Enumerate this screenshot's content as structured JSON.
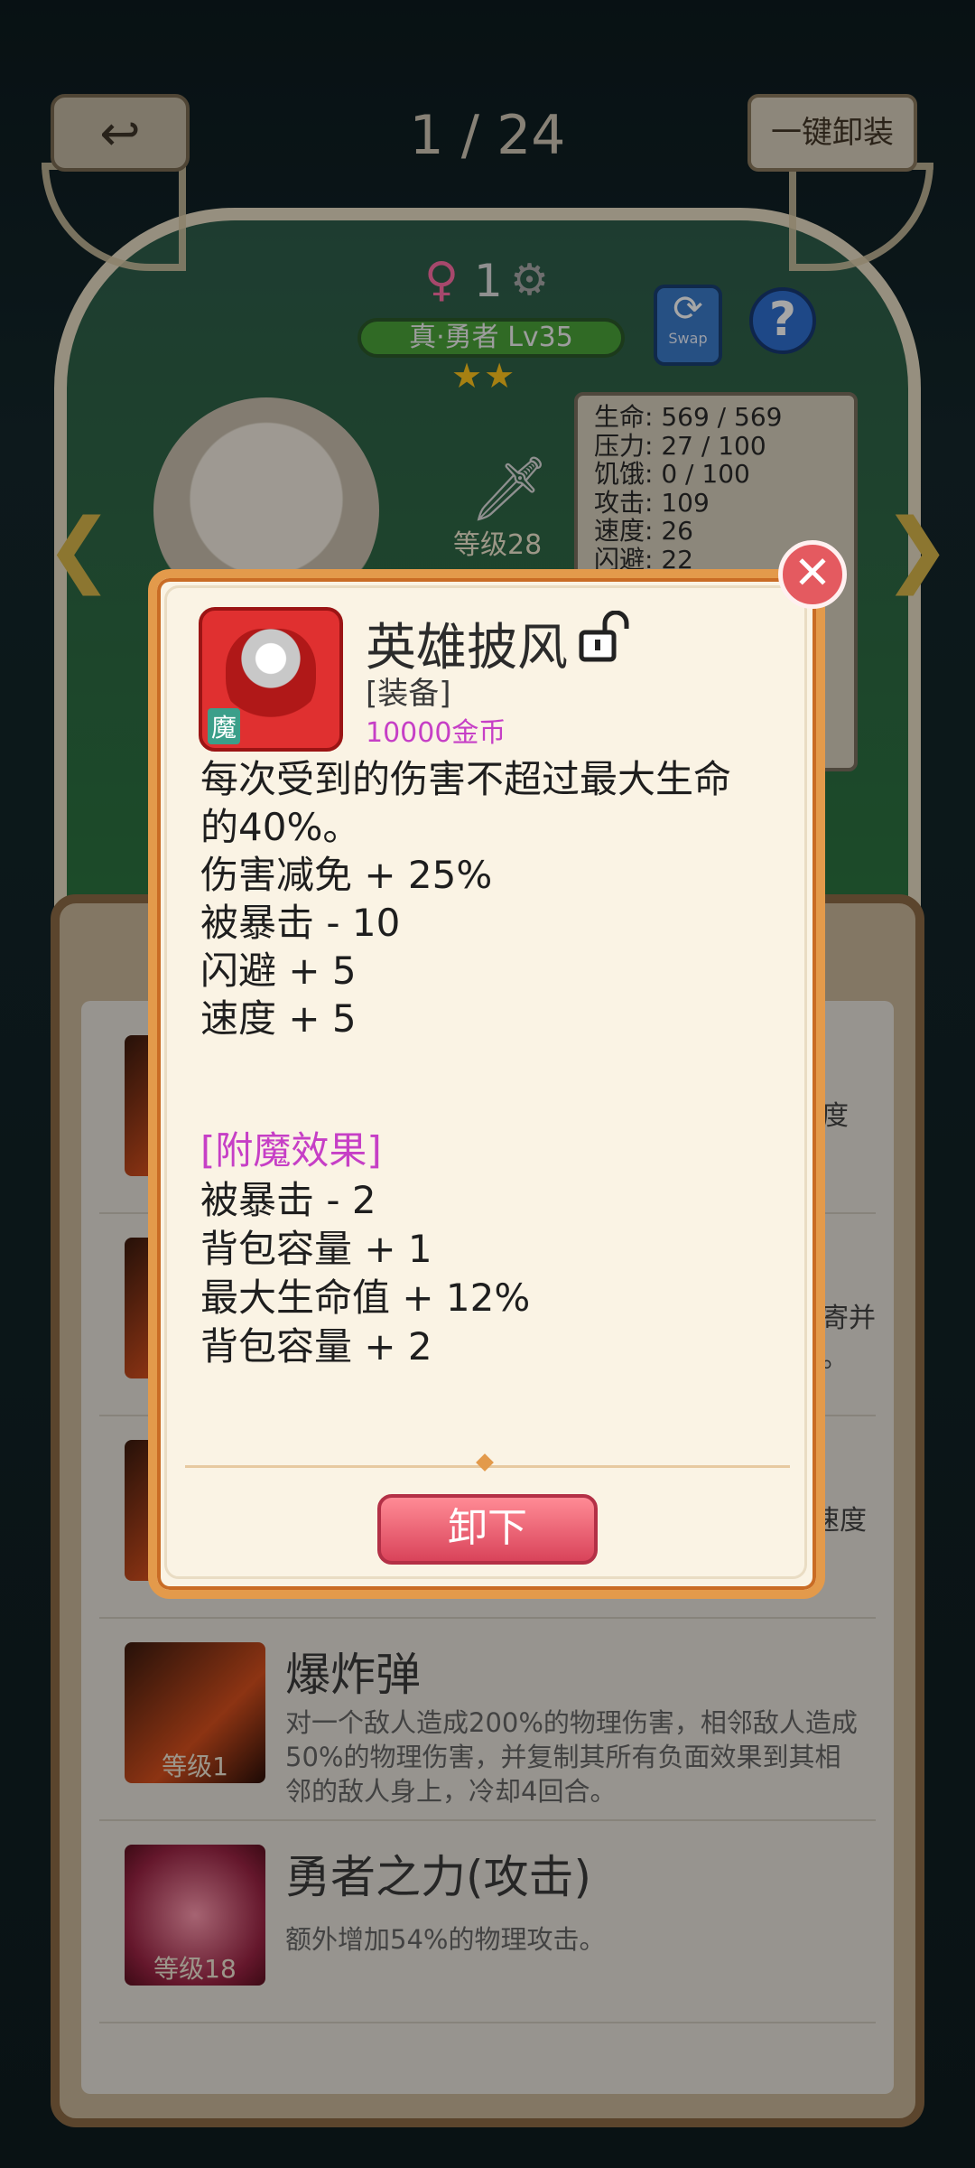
{
  "topbar": {
    "back_icon": "back-arrow-icon",
    "page_indicator": "1 / 24",
    "unequip_all_label": "一键卸装"
  },
  "hero": {
    "gender_symbol": "♀",
    "count": "1",
    "name": "真·勇者 Lv35",
    "stars": "★★",
    "swap_label": "Swap",
    "help_label": "?",
    "weapon_level": "等级28",
    "stats": [
      "生命: 569 / 569",
      "压力: 27 / 100",
      "饥饿: 0 / 100",
      "攻击: 109",
      "速度: 26",
      "闪避: 22"
    ]
  },
  "skills": [
    {
      "name": "",
      "desc": "度",
      "level": ""
    },
    {
      "name": "",
      "desc": "寄并\n。",
      "level": ""
    },
    {
      "name": "",
      "desc": "速度",
      "level": ""
    },
    {
      "name": "爆炸弹",
      "desc": "对一个敌人造成200%的物理伤害，相邻敌人造成50%的物理伤害，并复制其所有负面效果到其相邻的敌人身上，冷却4回合。",
      "level": "等级1"
    },
    {
      "name": "勇者之力(攻击)",
      "desc": "额外增加54%的物理攻击。",
      "level": "等级18"
    }
  ],
  "modal": {
    "close_label": "✕",
    "item_badge": "魔",
    "item_title": "英雄披风",
    "item_type": "[装备]",
    "item_price": "10000金币",
    "description_lines": [
      "每次受到的伤害不超过最大生命",
      "的40%。",
      "伤害减免 + 25%",
      "被暴击 - 10",
      "闪避 + 5",
      "速度 + 5"
    ],
    "enchant_heading": "[附魔效果]",
    "enchant_lines": [
      "被暴击 - 2",
      "背包容量 + 1",
      "最大生命值 + 12%",
      "背包容量 + 2"
    ],
    "unload_label": "卸下"
  },
  "colors": {
    "modal_border": "#e39a4b",
    "price": "#c63fc6",
    "unload_button": "#d9435a",
    "close_button": "#e45a60"
  }
}
